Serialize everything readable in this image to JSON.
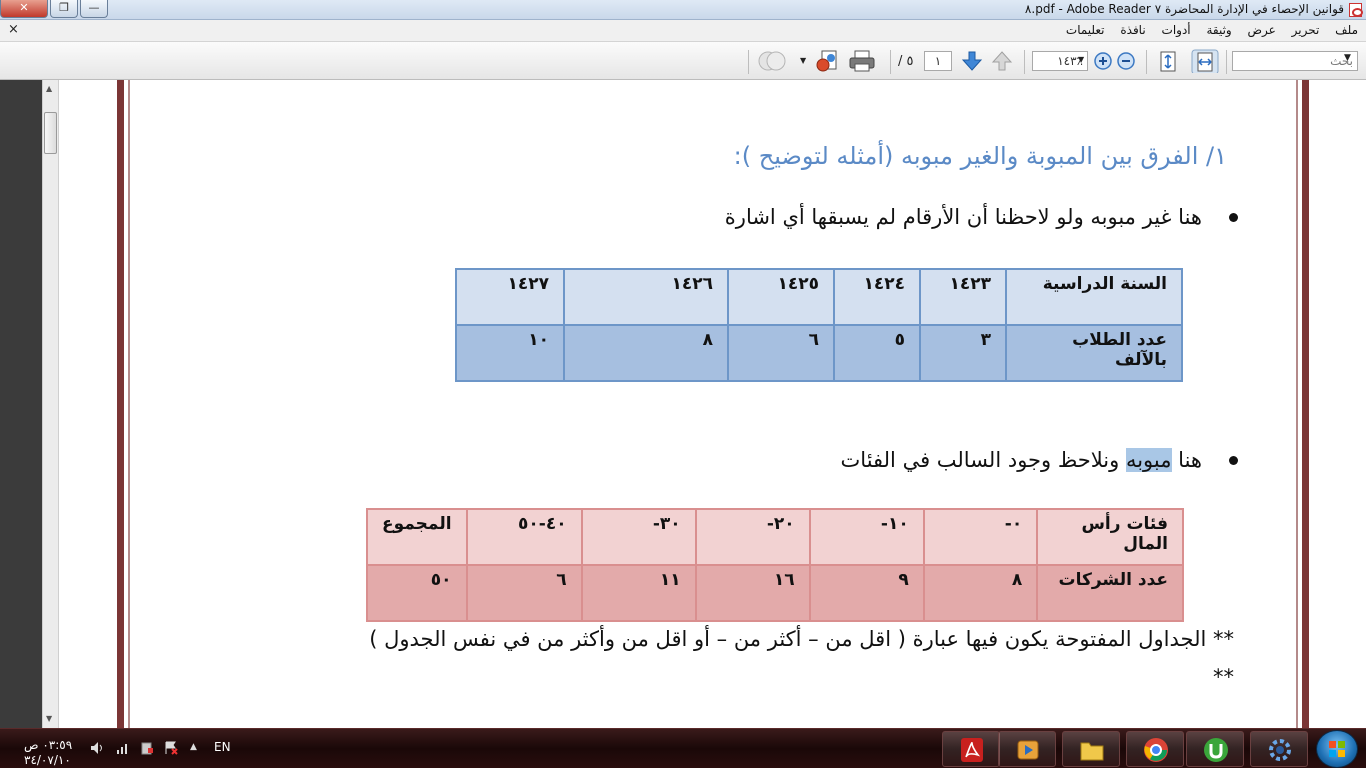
{
  "window": {
    "title": "قوانين الإحصاء في الإدارة المحاضرة ٧ pdf - Adobe Reader.٨",
    "close_glyph": "✕",
    "maximize_glyph": "❐",
    "minimize_glyph": "—"
  },
  "menubar": {
    "items": [
      "ملف",
      "تحرير",
      "عرض",
      "وثيقة",
      "أدوات",
      "نافذة",
      "تعليمات"
    ],
    "close_glyph": "×"
  },
  "toolbar": {
    "search_placeholder": "بحث",
    "zoom_value": "١٤٣٪",
    "page_current": "١",
    "page_total": "/ ٥",
    "dropdown_glyph": "▼"
  },
  "document": {
    "heading": "١/ الفرق بين المبوبة والغير مبوبه (أمثله لتوضيح ):",
    "bullet1": "هنا غير مبوبه ولو لاحظنا أن الأرقام لم يسبقها أي اشارة",
    "bullet2_part1": "هنا ",
    "bullet2_highlight": "مبوبه",
    "bullet2_part2": " ونلاحظ وجود السالب في الفئات",
    "table1": {
      "row1": [
        "السنة الدراسية",
        "١٤٢٣",
        "١٤٢٤",
        "١٤٢٥",
        "١٤٢٦",
        "١٤٢٧"
      ],
      "row2": [
        "عدد الطلاب بالآلف",
        "٣",
        "٥",
        "٦",
        "٨",
        "١٠"
      ]
    },
    "table2": {
      "row1": [
        "فئات رأس المال",
        "٠-",
        "١٠-",
        "٢٠-",
        "٣٠-",
        "٤٠-٥٠",
        "المجموع"
      ],
      "row2": [
        "عدد الشركات",
        "٨",
        "٩",
        "١٦",
        "١١",
        "٦",
        "٥٠"
      ]
    },
    "note": "** الجداول المفتوحة يكون فيها عبارة ( اقل من – أكثر من – أو اقل من وأكثر من في نفس الجدول ) **"
  },
  "taskbar": {
    "time": "٠٣:٥٩ ص",
    "date": "٣٤/٠٧/١٠",
    "language": "EN",
    "tray_arrow": "▲"
  },
  "colors": {
    "heading": "#5b8ac6",
    "table1_border": "#6d96c8",
    "table2_border": "#d98f8f",
    "page_border": "#7b3535"
  }
}
